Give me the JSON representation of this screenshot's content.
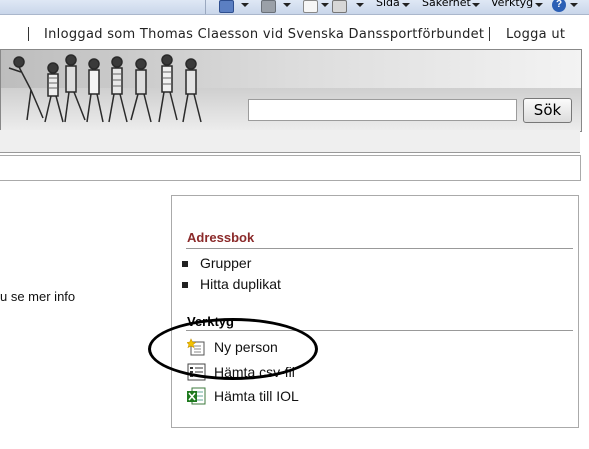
{
  "toolbar": {
    "menus": [
      "Sida",
      "Säkerhet",
      "Verktyg"
    ],
    "help_symbol": "?"
  },
  "header": {
    "logged_in_text": "Inloggad som Thomas Claesson vid Svenska Danssportförbundet",
    "logout_label": "Logga ut"
  },
  "search": {
    "value": "",
    "button_label": "Sök"
  },
  "main": {
    "partial_text": "u se mer info"
  },
  "sidebar": {
    "adressbok_title": "Adressbok",
    "adressbok_items": [
      "Grupper",
      "Hitta duplikat"
    ],
    "verktyg_title": "Verktyg",
    "verktyg_items": [
      {
        "label": "Ny person",
        "icon": "new-person-icon"
      },
      {
        "label": "Hämta csv-fil",
        "icon": "csv-list-icon"
      },
      {
        "label": "Hämta till IOL",
        "icon": "excel-icon"
      }
    ]
  },
  "colors": {
    "adressbok_title": "#8b2a2a",
    "annotation": "#000000"
  }
}
